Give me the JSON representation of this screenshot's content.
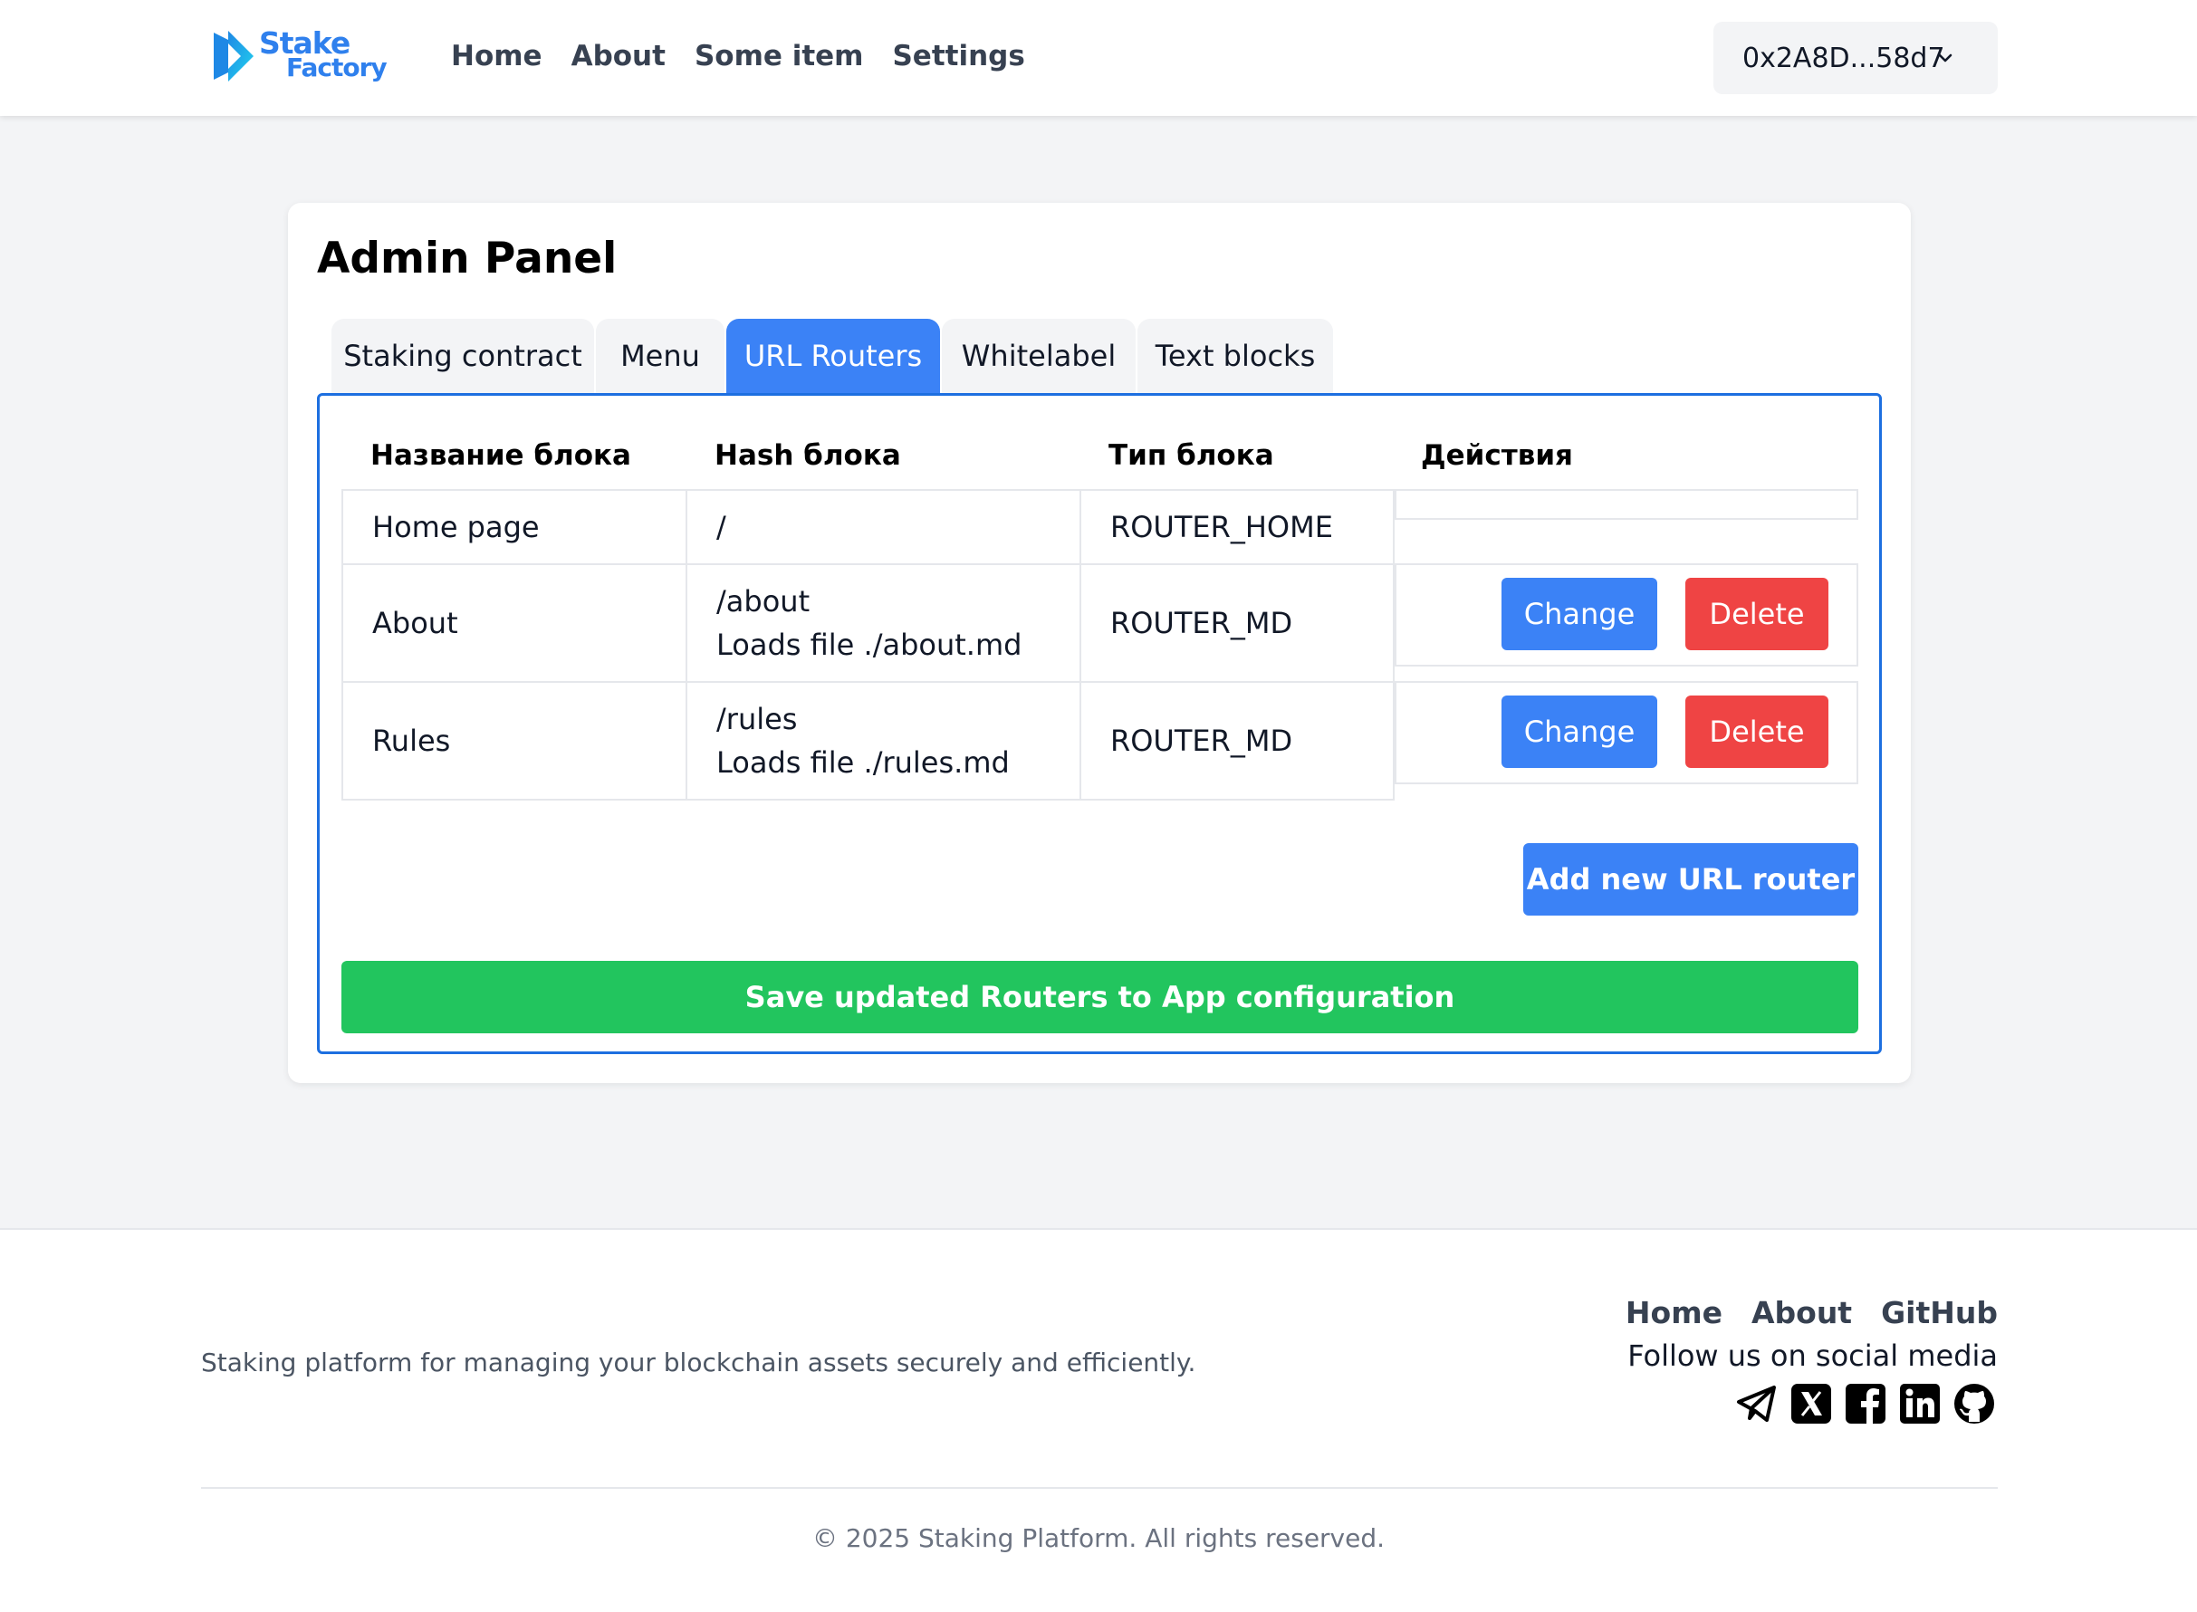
{
  "header": {
    "logo_line1": "Stake",
    "logo_line2": "Factory",
    "nav": [
      "Home",
      "About",
      "Some item",
      "Settings"
    ],
    "wallet": "0x2A8D...58d7",
    "wallet_icon": "chevron-down-icon"
  },
  "admin": {
    "title": "Admin Panel",
    "tabs": [
      "Staking contract",
      "Menu",
      "URL Routers",
      "Whitelabel",
      "Text blocks"
    ],
    "active_tab": "URL Routers",
    "columns": [
      "Название блока",
      "Hash блока",
      "Тип блока",
      "Действия"
    ],
    "rows": [
      {
        "name": "Home page",
        "hash": "/",
        "hash_note": "",
        "type": "ROUTER_HOME",
        "actions": false
      },
      {
        "name": "About",
        "hash": "/about",
        "hash_note": "Loads file ./about.md",
        "type": "ROUTER_MD",
        "actions": true
      },
      {
        "name": "Rules",
        "hash": "/rules",
        "hash_note": "Loads file ./rules.md",
        "type": "ROUTER_MD",
        "actions": true
      }
    ],
    "change_label": "Change",
    "delete_label": "Delete",
    "add_label": "Add new URL router",
    "save_label": "Save updated Routers to App configuration"
  },
  "footer": {
    "tagline": "Staking platform for managing your blockchain assets securely and efficiently.",
    "links": [
      "Home",
      "About",
      "GitHub"
    ],
    "follow": "Follow us on social media",
    "socials": [
      "telegram-icon",
      "x-icon",
      "facebook-icon",
      "linkedin-icon",
      "github-icon"
    ],
    "copyright": "© 2025 Staking Platform. All rights reserved."
  },
  "colors": {
    "primary": "#3b82f6",
    "danger": "#ef4444",
    "success": "#22c55e",
    "panel_border": "#1d6fe0"
  }
}
